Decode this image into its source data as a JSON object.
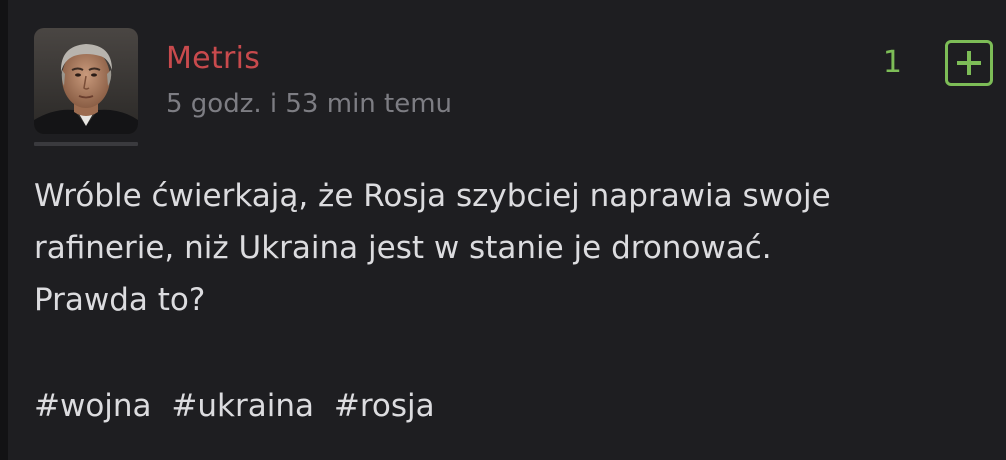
{
  "post": {
    "author": "Metris",
    "timestamp": "5 godz. i 53 min temu",
    "vote_count": "1",
    "content_lines": [
      "Wróble ćwierkają, że Rosja szybciej naprawia swoje",
      "rafinerie, niż Ukraina jest w stanie je dronować.",
      "Prawda to?"
    ],
    "tags": [
      "#wojna",
      "#ukraina",
      "#rosja"
    ]
  },
  "colors": {
    "background": "#1e1e21",
    "author": "#c84a4d",
    "timestamp": "#7d7d83",
    "vote_accent": "#7dbd57",
    "text": "#dcdcdf"
  },
  "icons": {
    "avatar": "avatar-photo",
    "plus": "plus-icon"
  }
}
